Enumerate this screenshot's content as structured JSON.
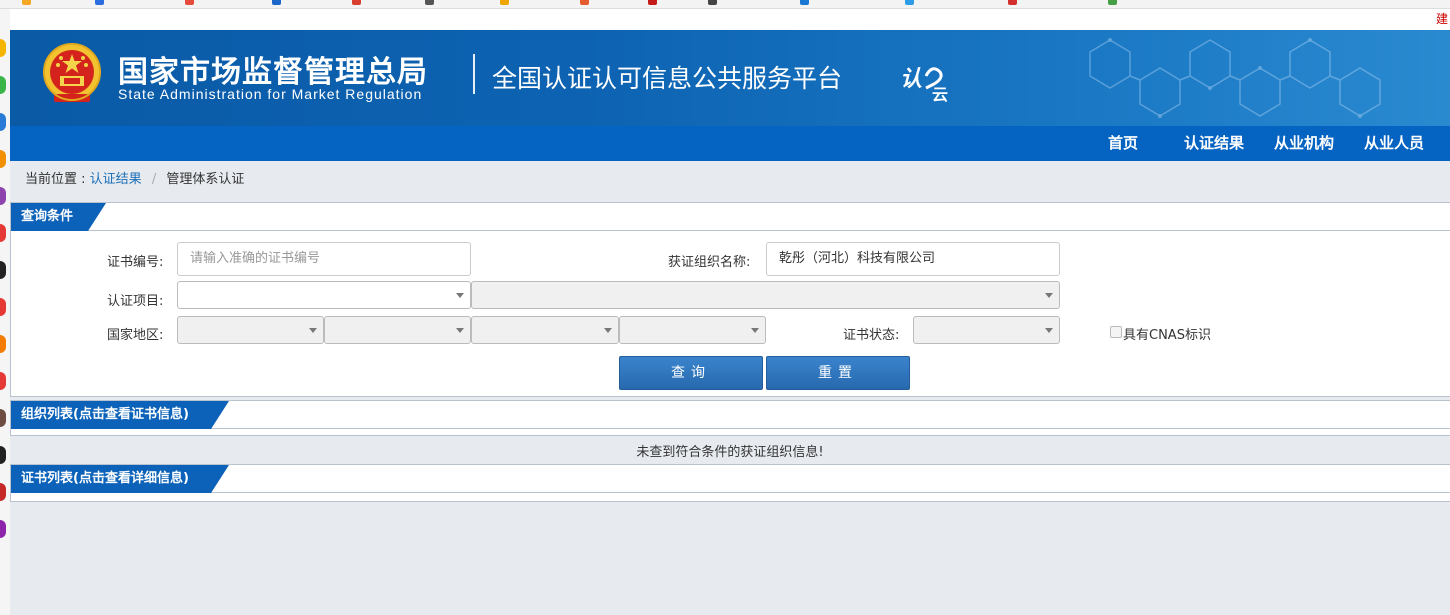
{
  "browser": {
    "bookmarks": [
      {
        "label": "",
        "color": "#f5a623"
      },
      {
        "label": "",
        "color": "#2b6de0"
      },
      {
        "label": "",
        "color": "#e44b3c"
      },
      {
        "label": "",
        "color": "#1a66c9"
      },
      {
        "label": "",
        "color": "#d93f2f"
      },
      {
        "label": "",
        "color": "#555555"
      },
      {
        "label": "",
        "color": "#f0a500"
      },
      {
        "label": "",
        "color": "#e65b2d"
      },
      {
        "label": "",
        "color": "#c41a1a"
      },
      {
        "label": "",
        "color": "#444444"
      },
      {
        "label": "",
        "color": "#1a77d2"
      },
      {
        "label": "",
        "color": "#2e9be6"
      },
      {
        "label": "",
        "color": "#d32f2f"
      },
      {
        "label": "",
        "color": "#45a045"
      }
    ],
    "sidebar_colors": [
      "#f5b400",
      "#3bb54a",
      "#2a7ad8",
      "#f29000",
      "#8e44ad",
      "#e53935",
      "#222222",
      "#e53935",
      "#f57c00",
      "#e53935",
      "#6d4c41",
      "#222222",
      "#c62828",
      "#8e24aa"
    ]
  },
  "header": {
    "top_link": "建",
    "title_cn": "国家市场监督管理总局",
    "title_en": "State Administration  for  Market Regulation",
    "platform": "全国认证认可信息公共服务平台",
    "logo_text": "认证云"
  },
  "nav": {
    "items": [
      "首页",
      "认证结果",
      "从业机构",
      "从业人员"
    ]
  },
  "breadcrumb": {
    "prefix": "当前位置 :",
    "link": "认证结果",
    "separator": "/",
    "current": "管理体系认证"
  },
  "query": {
    "title": "查询条件",
    "cert_no_label": "证书编号:",
    "cert_no_placeholder": "请输入准确的证书编号",
    "org_label": "获证组织名称:",
    "org_value": "乾彤（河北）科技有限公司",
    "project_label": "认证项目:",
    "region_label": "国家地区:",
    "status_label": "证书状态:",
    "cnas_label": "具有CNAS标识",
    "search_button": "查询",
    "reset_button": "重置"
  },
  "org_list": {
    "title": "组织列表(点击查看证书信息)",
    "empty_message": "未查到符合条件的获证组织信息!"
  },
  "cert_list": {
    "title": "证书列表(点击查看详细信息)"
  }
}
